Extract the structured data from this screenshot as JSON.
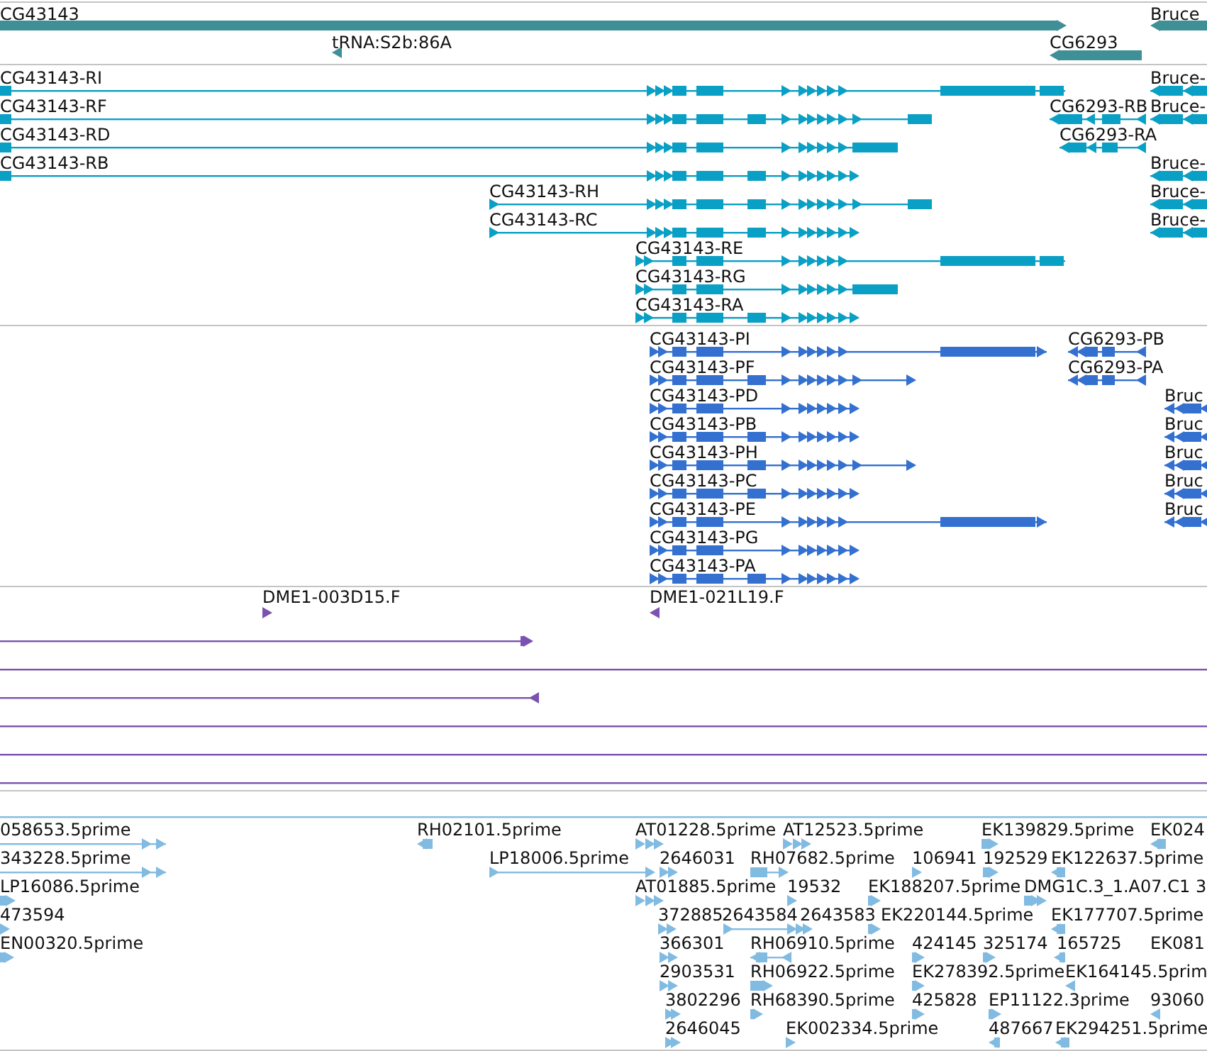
{
  "tracks": [
    {
      "kind": "gene",
      "features": [
        {
          "label": "CG43143"
        },
        {
          "label": "Bruce"
        },
        {
          "label": "tRNA:S2b:86A"
        },
        {
          "label": "CG6293"
        }
      ]
    },
    {
      "kind": "transcript",
      "features": [
        {
          "label": "CG43143-RI"
        },
        {
          "label": "Bruce-"
        },
        {
          "label": "CG43143-RF"
        },
        {
          "label": "CG6293-RB"
        },
        {
          "label": "Bruce-"
        },
        {
          "label": "CG43143-RD"
        },
        {
          "label": "CG6293-RA"
        },
        {
          "label": "CG43143-RB"
        },
        {
          "label": "Bruce-"
        },
        {
          "label": "CG43143-RH"
        },
        {
          "label": "Bruce-"
        },
        {
          "label": "CG43143-RC"
        },
        {
          "label": "Bruce-"
        },
        {
          "label": "CG43143-RE"
        },
        {
          "label": "CG43143-RG"
        },
        {
          "label": "CG43143-RA"
        }
      ]
    },
    {
      "kind": "protein",
      "features": [
        {
          "label": "CG43143-PI"
        },
        {
          "label": "CG6293-PB"
        },
        {
          "label": "CG43143-PF"
        },
        {
          "label": "CG6293-PA"
        },
        {
          "label": "CG43143-PD"
        },
        {
          "label": "Bruc"
        },
        {
          "label": "CG43143-PB"
        },
        {
          "label": "Bruc"
        },
        {
          "label": "CG43143-PH"
        },
        {
          "label": "Bruc"
        },
        {
          "label": "CG43143-PC"
        },
        {
          "label": "Bruc"
        },
        {
          "label": "CG43143-PE"
        },
        {
          "label": "Bruc"
        },
        {
          "label": "CG43143-PG"
        },
        {
          "label": "CG43143-PA"
        }
      ]
    },
    {
      "kind": "clone",
      "features": [
        {
          "label": "DME1-003D15.F"
        },
        {
          "label": "DME1-021L19.F"
        }
      ]
    },
    {
      "kind": "est",
      "features": [
        {
          "label": "058653.5prime"
        },
        {
          "label": "RH02101.5prime"
        },
        {
          "label": "AT01228.5prime"
        },
        {
          "label": "AT12523.5prime"
        },
        {
          "label": "EK139829.5prime"
        },
        {
          "label": "EK024"
        },
        {
          "label": "343228.5prime"
        },
        {
          "label": "LP18006.5prime"
        },
        {
          "label": "2646031"
        },
        {
          "label": "RH07682.5prime"
        },
        {
          "label": "106941"
        },
        {
          "label": "192529"
        },
        {
          "label": "EK122637.5prime"
        },
        {
          "label": "LP16086.5prime"
        },
        {
          "label": "AT01885.5prime"
        },
        {
          "label": "19532"
        },
        {
          "label": "EK188207.5prime"
        },
        {
          "label": "DMG1C.3_1.A07.C1"
        },
        {
          "label": "3"
        },
        {
          "label": "473594"
        },
        {
          "label": "372885"
        },
        {
          "label": "2643584"
        },
        {
          "label": "2643583"
        },
        {
          "label": "EK220144.5prime"
        },
        {
          "label": "EK177707.5prime"
        },
        {
          "label": "EN00320.5prime"
        },
        {
          "label": "366301"
        },
        {
          "label": "RH06910.5prime"
        },
        {
          "label": "424145"
        },
        {
          "label": "325174"
        },
        {
          "label": "165725"
        },
        {
          "label": "EK081"
        },
        {
          "label": "2903531"
        },
        {
          "label": "RH06922.5prime"
        },
        {
          "label": "EK278392.5prime"
        },
        {
          "label": "EK164145.5prim"
        },
        {
          "label": "3802296"
        },
        {
          "label": "RH68390.5prime"
        },
        {
          "label": "425828"
        },
        {
          "label": "EP11122.3prime"
        },
        {
          "label": "93060"
        },
        {
          "label": "2646045"
        },
        {
          "label": "EK002334.5prime"
        },
        {
          "label": "487667"
        },
        {
          "label": "EK294251.5prime"
        }
      ]
    }
  ]
}
